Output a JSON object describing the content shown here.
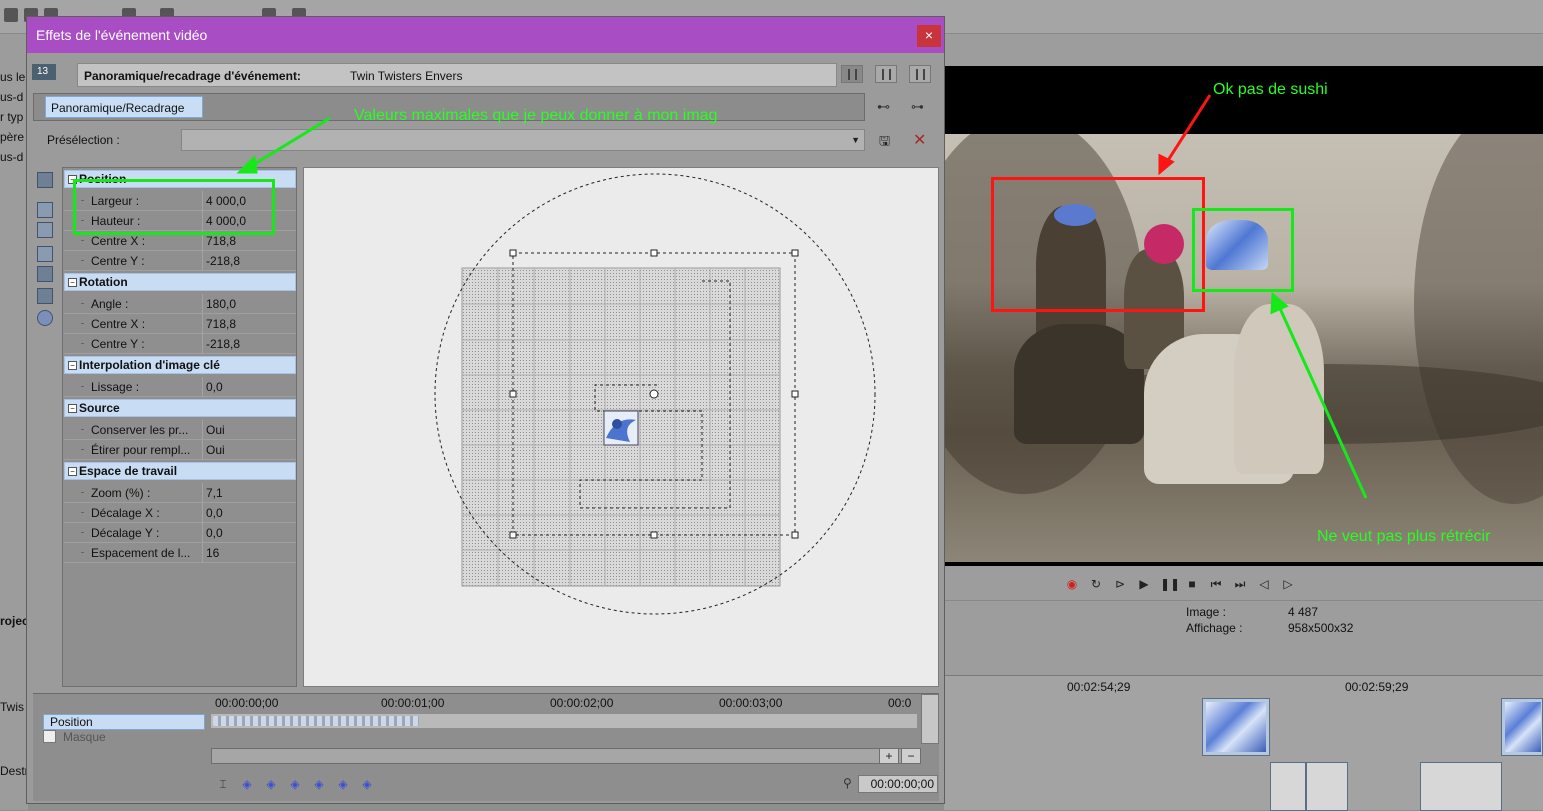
{
  "dialog": {
    "title": "Effets de l'événement vidéo",
    "close_glyph": "×",
    "fx_badge": "13",
    "header_label": "Panoramique/recadrage d'événement:",
    "header_value": "Twin Twisters Envers",
    "chain_tab": "Panoramique/Recadrage",
    "preset_label": "Présélection :",
    "preset_value": ""
  },
  "properties": {
    "sections": [
      {
        "title": "Position",
        "rows": [
          {
            "label": "Largeur :",
            "value": "4 000,0"
          },
          {
            "label": "Hauteur :",
            "value": "4 000,0"
          },
          {
            "label": "Centre X :",
            "value": "718,8"
          },
          {
            "label": "Centre Y :",
            "value": "-218,8"
          }
        ]
      },
      {
        "title": "Rotation",
        "rows": [
          {
            "label": "Angle :",
            "value": "180,0"
          },
          {
            "label": "Centre X :",
            "value": "718,8"
          },
          {
            "label": "Centre Y :",
            "value": "-218,8"
          }
        ]
      },
      {
        "title": "Interpolation d'image clé",
        "rows": [
          {
            "label": "Lissage :",
            "value": "0,0"
          }
        ]
      },
      {
        "title": "Source",
        "rows": [
          {
            "label": "Conserver les pr...",
            "value": "Oui"
          },
          {
            "label": "Étirer pour rempl...",
            "value": "Oui"
          }
        ]
      },
      {
        "title": "Espace de travail",
        "rows": [
          {
            "label": "Zoom (%) :",
            "value": "7,1"
          },
          {
            "label": "Décalage X :",
            "value": "0,0"
          },
          {
            "label": "Décalage Y :",
            "value": "0,0"
          },
          {
            "label": "Espacement de l...",
            "value": "16"
          }
        ]
      }
    ]
  },
  "keyframes": {
    "ruler": [
      "00:00:00;00",
      "00:00:01;00",
      "00:00:02;00",
      "00:00:03;00",
      "00:0"
    ],
    "tracks": {
      "position": "Position",
      "mask": "Masque"
    },
    "time": "00:00:00;00",
    "zoom_in": "+",
    "zoom_out": "−"
  },
  "annotations": {
    "max_values": "Valeurs maximales que je peux donner à mon imag",
    "ok_sushi": "Ok pas de sushi",
    "no_shrink": "Ne veut pas plus rétrécir",
    "colors": {
      "red": "#ff1414",
      "green": "#17e81a"
    }
  },
  "preview": {
    "image_label": "Image :",
    "image_value": "4 487",
    "display_label": "Affichage :",
    "display_value": "958x500x32"
  },
  "timeline": {
    "ruler": [
      "00:02:54;29",
      "00:02:59;29"
    ]
  },
  "left_panel": {
    "items": [
      "us le",
      "us-d",
      "r typ",
      "père",
      "us-d",
      "rojec",
      "Twis",
      "Destr"
    ]
  }
}
